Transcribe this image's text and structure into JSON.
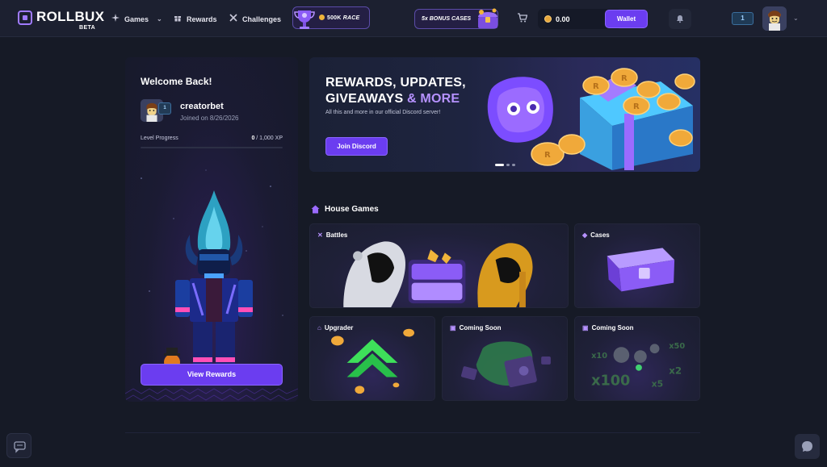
{
  "brand": {
    "name_a": "ROLL",
    "name_b": "BUX",
    "tag": "BETA"
  },
  "nav": {
    "games": "Games",
    "rewards": "Rewards",
    "challenges": "Challenges",
    "race": {
      "amount": "500K",
      "label": "RACE"
    },
    "bonus": "5x BONUS CASES",
    "balance": "0.00",
    "wallet": "Wallet",
    "level": "1"
  },
  "profile": {
    "welcome": "Welcome Back!",
    "username": "creatorbet",
    "level": "1",
    "joined": "Joined on 8/26/2026",
    "progress_label": "Level Progress",
    "progress_current": "0",
    "progress_total": "/ 1,000 XP",
    "progress_fraction": 0,
    "view_rewards": "View Rewards"
  },
  "banner": {
    "line1": "REWARDS, UPDATES,",
    "line2": "GIVEAWAYS",
    "line2_accent": "& MORE",
    "subtitle": "All this and more in our official Discord server!",
    "cta": "Join Discord",
    "slides": 3,
    "active_slide": 0
  },
  "house_games": {
    "title": "House Games",
    "tiles": {
      "battles": "Battles",
      "cases": "Cases",
      "upgrader": "Upgrader",
      "coming1": "Coming Soon",
      "coming2": "Coming Soon"
    }
  },
  "colors": {
    "accent": "#6b3df0",
    "accent_light": "#b692ff",
    "background": "#161a26",
    "panel": "#1c2030"
  }
}
